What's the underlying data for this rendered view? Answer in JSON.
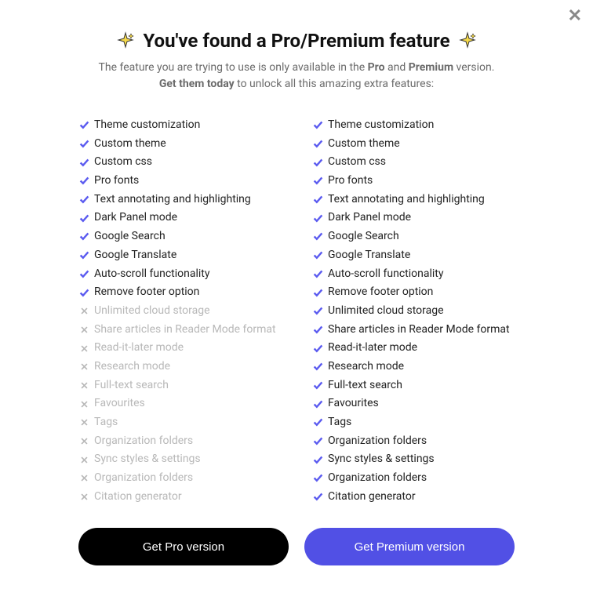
{
  "header": {
    "title": "You've found a Pro/Premium feature",
    "subtitle_prefix": "The feature you are trying to use is only available in the ",
    "pro_word": "Pro",
    "and_word": " and ",
    "premium_word": "Premium",
    "subtitle_suffix": " version.",
    "subtitle2_bold": "Get them today",
    "subtitle2_rest": " to unlock all this amazing extra features:"
  },
  "features": [
    "Theme customization",
    "Custom theme",
    "Custom css",
    "Pro fonts",
    "Text annotating and highlighting",
    "Dark Panel mode",
    "Google Search",
    "Google Translate",
    "Auto-scroll functionality",
    "Remove footer option",
    "Unlimited cloud storage",
    "Share articles in Reader Mode format",
    "Read-it-later mode",
    "Research mode",
    "Full-text search",
    "Favourites",
    "Tags",
    "Organization folders",
    "Sync styles & settings",
    "Organization folders",
    "Citation generator"
  ],
  "plans": {
    "pro": {
      "included": [
        true,
        true,
        true,
        true,
        true,
        true,
        true,
        true,
        true,
        true,
        false,
        false,
        false,
        false,
        false,
        false,
        false,
        false,
        false,
        false,
        false
      ],
      "button": "Get Pro version"
    },
    "premium": {
      "included": [
        true,
        true,
        true,
        true,
        true,
        true,
        true,
        true,
        true,
        true,
        true,
        true,
        true,
        true,
        true,
        true,
        true,
        true,
        true,
        true,
        true
      ],
      "button": "Get Premium version"
    }
  },
  "icons": {
    "sparkle": "sparkle-icon",
    "check": "check-icon",
    "x": "x-icon",
    "close": "close-icon"
  }
}
